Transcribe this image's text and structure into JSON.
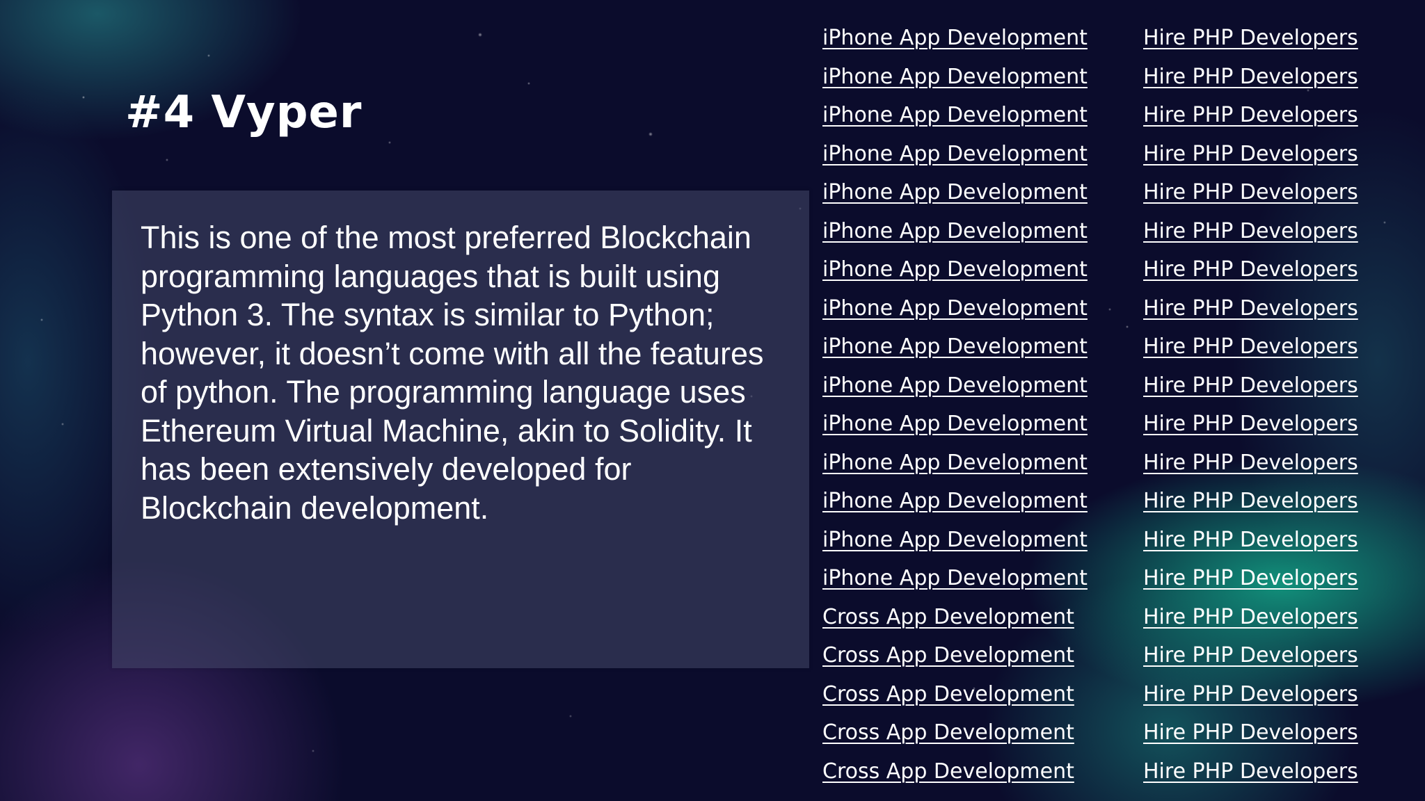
{
  "slide": {
    "title": "#4 Vyper",
    "body": "This is one of the most preferred Blockchain programming languages that is built using Python 3. The syntax is similar to Python; however, it doesn’t come with all the features of python. The programming language uses Ethereum Virtual Machine, akin to Solidity. It has been extensively developed for Blockchain development."
  },
  "links": {
    "left": [
      "iPhone App Development",
      "iPhone App Development",
      "iPhone App Development",
      "iPhone App Development",
      "iPhone App Development",
      "iPhone App Development",
      "iPhone App Development",
      "iPhone App Development",
      "iPhone App Development",
      "iPhone App Development",
      "iPhone App Development",
      "iPhone App Development",
      "iPhone App Development",
      "iPhone App Development",
      "iPhone App Development",
      "Cross App Development",
      "Cross App Development",
      "Cross App Development",
      "Cross App Development",
      "Cross App Development"
    ],
    "right": [
      "Hire PHP Developers",
      "Hire PHP Developers",
      "Hire PHP Developers",
      "Hire PHP Developers",
      "Hire PHP Developers",
      "Hire PHP Developers",
      "Hire PHP Developers",
      "Hire PHP Developers",
      "Hire PHP Developers",
      "Hire PHP Developers",
      "Hire PHP Developers",
      "Hire PHP Developers",
      "Hire PHP Developers",
      "Hire PHP Developers",
      "Hire PHP Developers",
      "Hire PHP Developers",
      "Hire PHP Developers",
      "Hire PHP Developers",
      "Hire PHP Developers",
      "Hire PHP Developers"
    ]
  },
  "colors": {
    "background": "#0b0c2c",
    "aurora_green": "#14be96",
    "aurora_purple": "#6e3c96",
    "text": "#ffffff"
  }
}
